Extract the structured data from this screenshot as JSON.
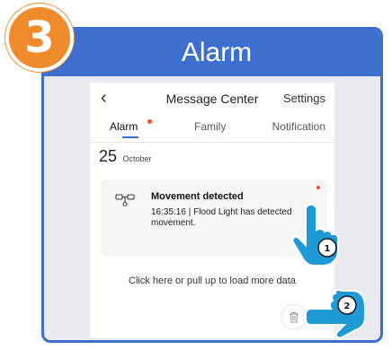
{
  "step": {
    "number": "3"
  },
  "banner": {
    "title": "Alarm"
  },
  "app": {
    "top_bar": {
      "back_icon": "chevron-left-icon",
      "title": "Message Center",
      "settings_label": "Settings"
    },
    "tabs": [
      {
        "label": "Alarm",
        "active": true,
        "has_badge": true
      },
      {
        "label": "Family",
        "active": false
      },
      {
        "label": "Notification",
        "active": false
      }
    ],
    "date": {
      "day": "25",
      "month": "October"
    },
    "message": {
      "icon": "floodlight-camera-icon",
      "title": "Movement detected",
      "body": "16:35:16 | Flood Light has detected movement.",
      "unread": true
    },
    "load_more_label": "Click here or pull up to load more data",
    "trash_icon": "trash-icon"
  },
  "callouts": [
    {
      "number": "1",
      "target": "message"
    },
    {
      "number": "2",
      "target": "trash"
    }
  ],
  "colors": {
    "accent": "#3d6fcf",
    "step_badge": "#f08b2c",
    "badge_dot": "#f04a2a",
    "hand_blue": "#1e9ad6"
  }
}
